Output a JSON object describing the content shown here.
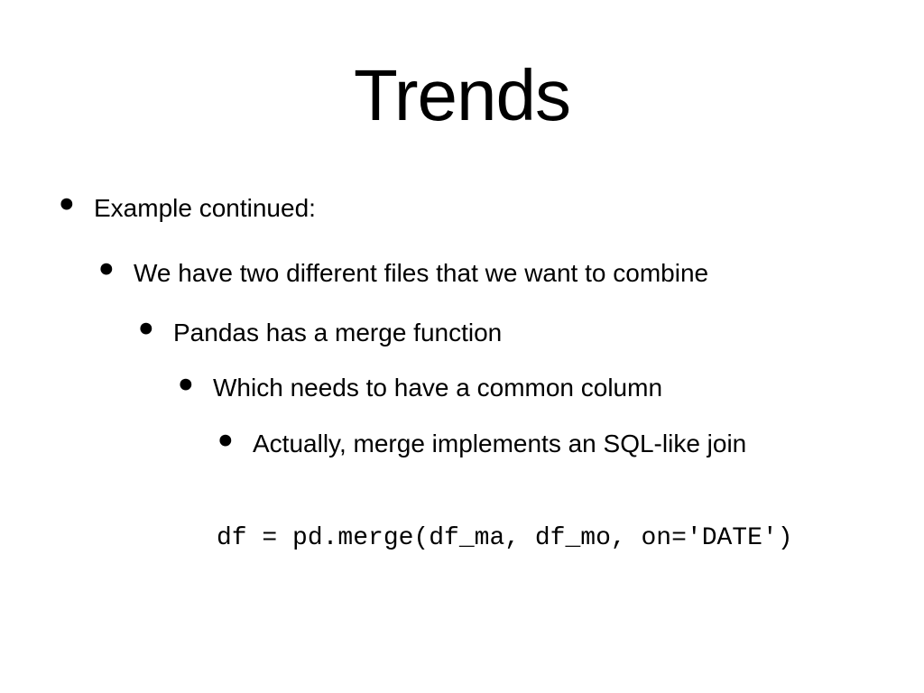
{
  "title": "Trends",
  "bullets": {
    "l1": "Example continued:",
    "l2": "We have two different files that we want to combine",
    "l3": "Pandas has a merge function",
    "l4": "Which needs to have a common column",
    "l5": "Actually, merge implements an SQL-like join"
  },
  "code": "df = pd.merge(df_ma, df_mo, on='DATE')"
}
